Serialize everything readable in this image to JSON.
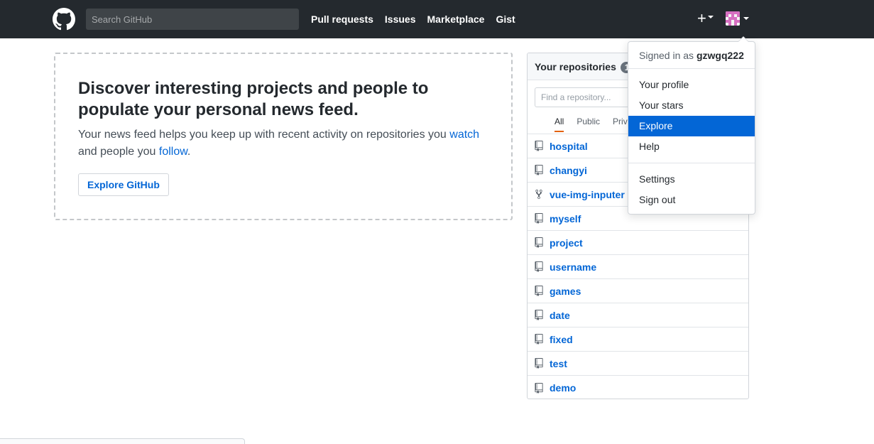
{
  "header": {
    "search_placeholder": "Search GitHub",
    "nav": [
      "Pull requests",
      "Issues",
      "Marketplace",
      "Gist"
    ],
    "new_label": "+"
  },
  "news_feed": {
    "title": "Discover interesting projects and people to populate your personal news feed.",
    "text_before": "Your news feed helps you keep up with recent activity on repositories you ",
    "watch_link": "watch",
    "text_middle": " and people you ",
    "follow_link": "follow",
    "text_end": ".",
    "button": "Explore GitHub"
  },
  "repositories": {
    "title": "Your repositories",
    "count": "11",
    "filter_placeholder": "Find a repository...",
    "tabs": [
      "All",
      "Public",
      "Priv"
    ],
    "items": [
      {
        "name": "hospital",
        "icon": "repo-icon"
      },
      {
        "name": "changyi",
        "icon": "repo-icon"
      },
      {
        "name": "vue-img-inputer",
        "icon": "fork-icon"
      },
      {
        "name": "myself",
        "icon": "repo-icon"
      },
      {
        "name": "project",
        "icon": "repo-icon"
      },
      {
        "name": "username",
        "icon": "repo-icon"
      },
      {
        "name": "games",
        "icon": "repo-icon"
      },
      {
        "name": "date",
        "icon": "repo-icon"
      },
      {
        "name": "fixed",
        "icon": "repo-icon"
      },
      {
        "name": "test",
        "icon": "repo-icon"
      },
      {
        "name": "demo",
        "icon": "repo-icon"
      }
    ]
  },
  "user_menu": {
    "signed_in_prefix": "Signed in as ",
    "username": "gzwgq222",
    "items": [
      "Your profile",
      "Your stars",
      "Explore",
      "Help"
    ],
    "active_item": "Explore",
    "settings_items": [
      "Settings",
      "Sign out"
    ]
  },
  "colors": {
    "header_bg": "#24292e",
    "link": "#0366d6",
    "active_menu_bg": "#0366d6"
  }
}
